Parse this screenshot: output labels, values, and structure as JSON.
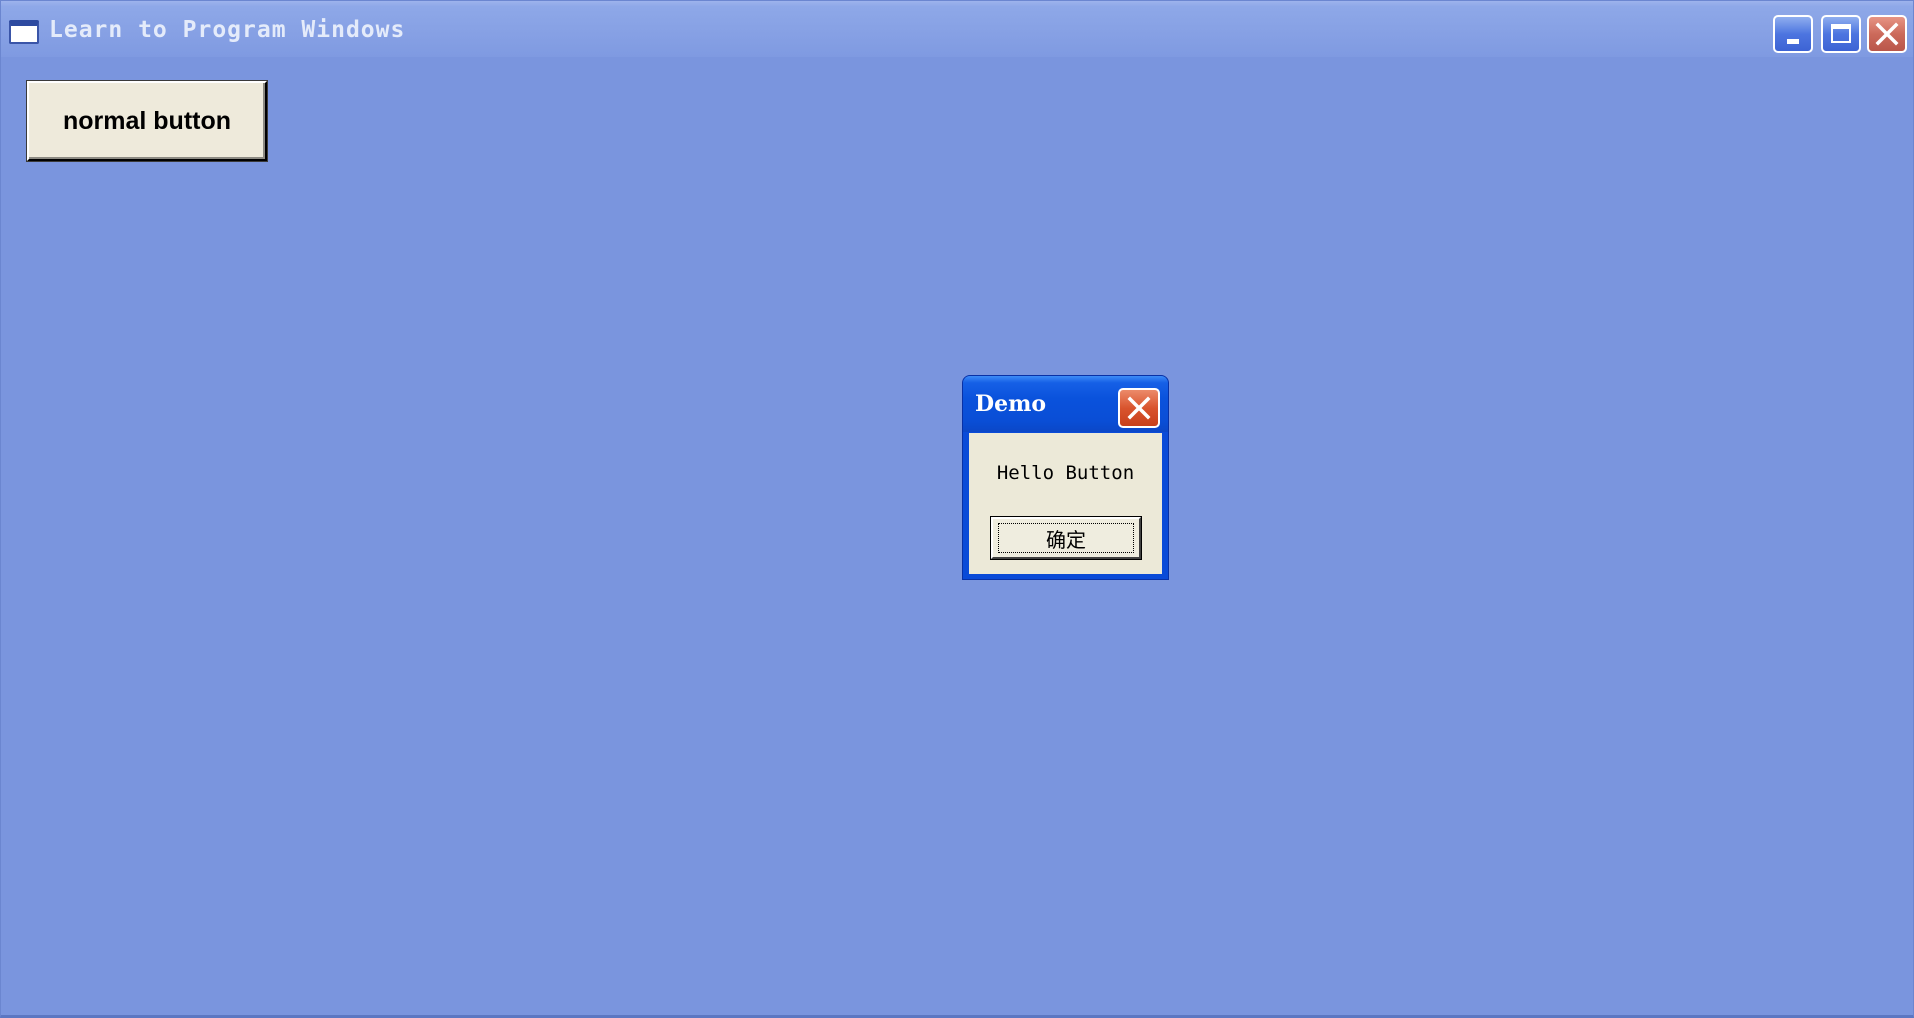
{
  "window": {
    "title": "Learn to Program Windows",
    "icon": "app-window-icon",
    "controls": [
      "minimize-icon",
      "maximize-icon",
      "close-icon"
    ]
  },
  "main": {
    "normal_button_label": "normal button"
  },
  "dialog": {
    "title": "Demo",
    "message": "Hello Button",
    "ok_label": "确定",
    "close_icon": "close-icon"
  },
  "colors": {
    "desktop_background": "#7a95de",
    "dialog_titlebar": "#0a52dc",
    "dialog_body": "#ece9d8",
    "close_button": "#d9542e",
    "button_face": "#eeeadb"
  }
}
